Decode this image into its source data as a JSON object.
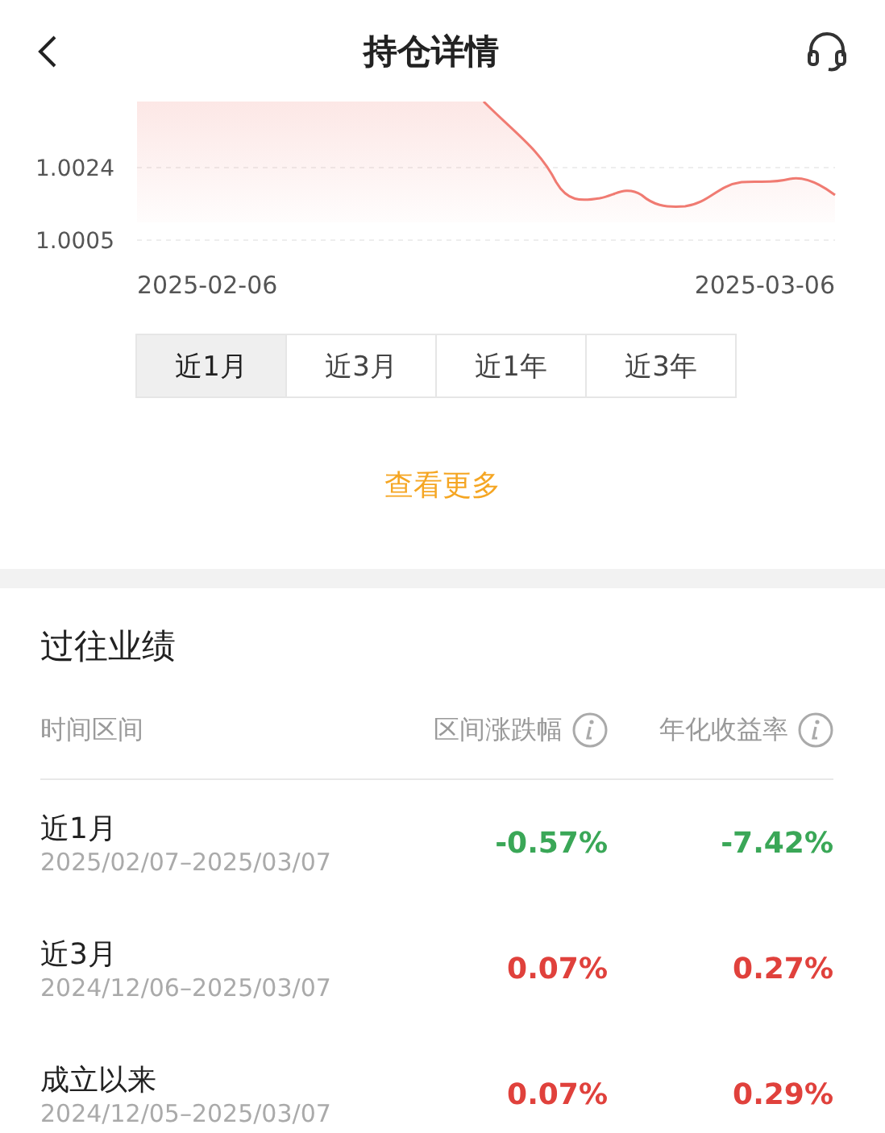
{
  "header": {
    "title": "持仓详情"
  },
  "chart": {
    "y_labels": [
      "1.0024",
      "1.0005"
    ],
    "x_labels": [
      "2025-02-06",
      "2025-03-06"
    ]
  },
  "periods": [
    {
      "label": "近1月",
      "selected": true
    },
    {
      "label": "近3月",
      "selected": false
    },
    {
      "label": "近1年",
      "selected": false
    },
    {
      "label": "近3年",
      "selected": false
    }
  ],
  "more_link": "查看更多",
  "performance": {
    "title": "过往业绩",
    "columns": [
      "时间区间",
      "区间涨跌幅",
      "年化收益率"
    ],
    "rows": [
      {
        "period": "近1月",
        "dates": "2025/02/07–2025/03/07",
        "change": "-0.57%",
        "annualized": "-7.42%",
        "color": "#3aa757"
      },
      {
        "period": "近3月",
        "dates": "2024/12/06–2025/03/07",
        "change": "0.07%",
        "annualized": "0.27%",
        "color": "#e0413c"
      },
      {
        "period": "成立以来",
        "dates": "2024/12/05–2025/03/07",
        "change": "0.07%",
        "annualized": "0.29%",
        "color": "#e0413c"
      }
    ]
  }
}
